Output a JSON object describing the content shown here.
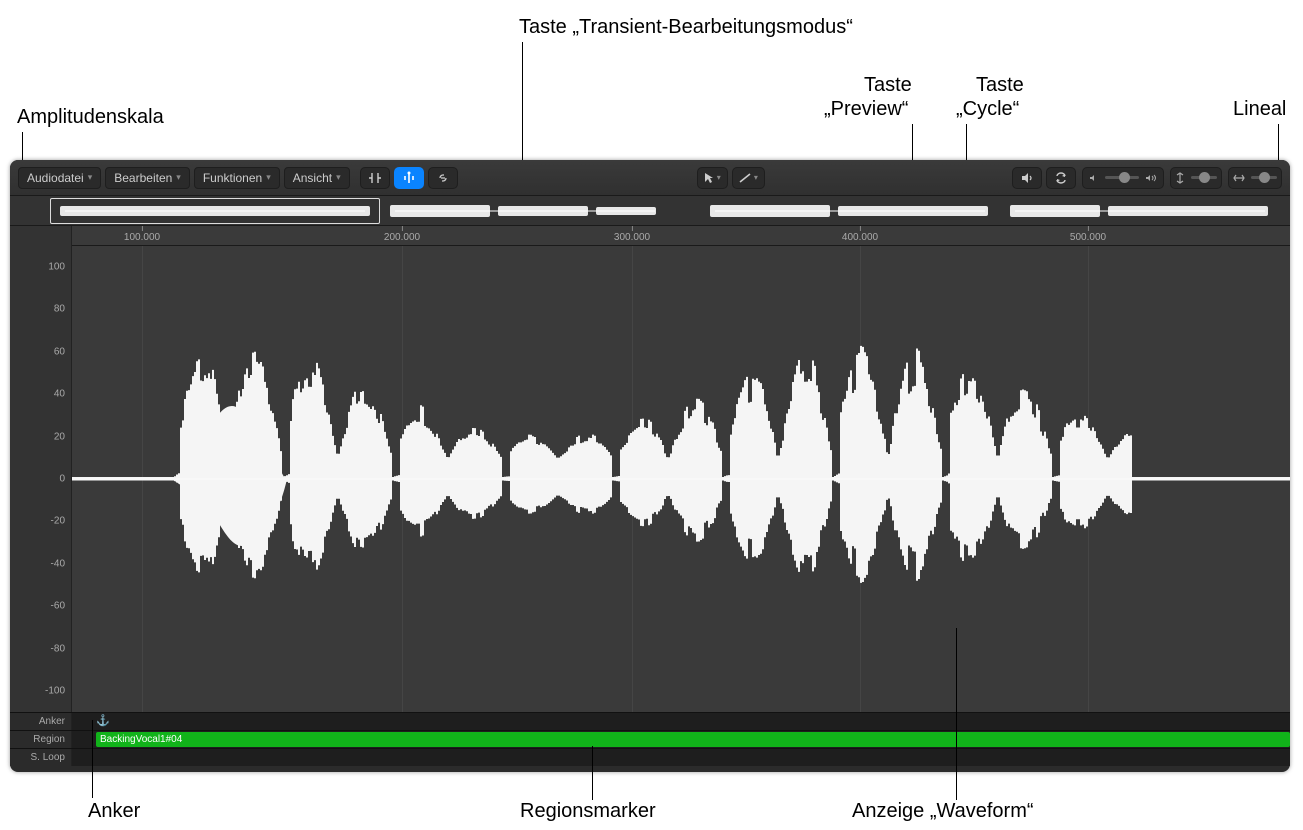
{
  "annotations": {
    "amplitudeScale": "Amplitudenskala",
    "transientMode": "Taste „Transient-Bearbeitungsmodus“",
    "preview": "Taste",
    "previewQuoted": "„Preview“",
    "cycle": "Taste",
    "cycleQuoted": "„Cycle“",
    "ruler": "Lineal",
    "anchor": "Anker",
    "regionMarker": "Regionsmarker",
    "waveformDisplay": "Anzeige „Waveform“"
  },
  "toolbar": {
    "menus": [
      {
        "label": "Audiodatei"
      },
      {
        "label": "Bearbeiten"
      },
      {
        "label": "Funktionen"
      },
      {
        "label": "Ansicht"
      }
    ]
  },
  "ruler": {
    "ticks": [
      "100.000",
      "200.000",
      "300.000",
      "400.000",
      "500.000"
    ]
  },
  "amplitudeScale": {
    "labels": [
      "100",
      "80",
      "60",
      "40",
      "20",
      "0",
      "-20",
      "-40",
      "-60",
      "-80",
      "-100"
    ]
  },
  "tracks": {
    "anchorLabel": "Anker",
    "regionLabel": "Region",
    "sLoopLabel": "S. Loop",
    "regionName": "BackingVocal1#04"
  }
}
